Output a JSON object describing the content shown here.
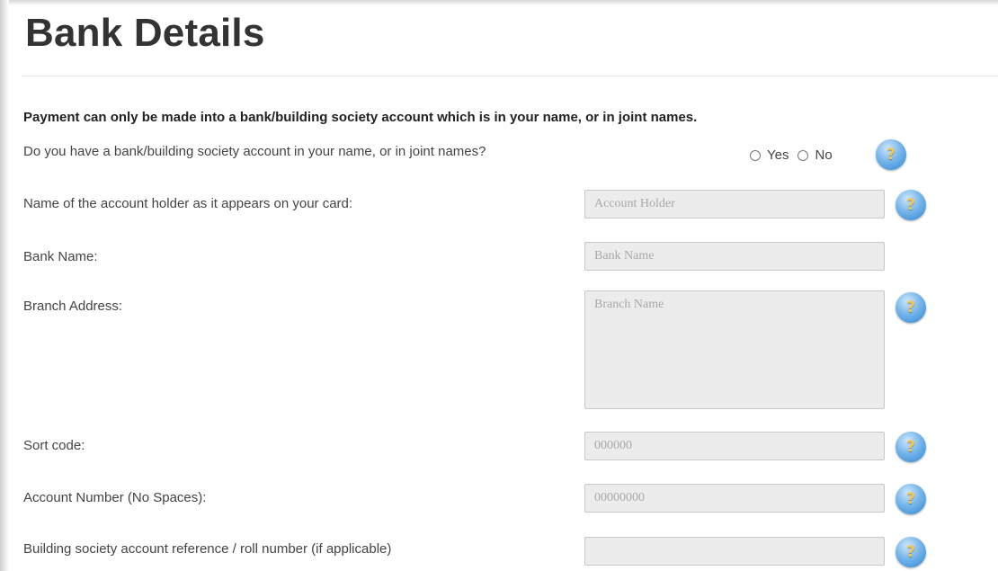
{
  "page": {
    "title": "Bank Details",
    "notice": "Payment can only be made into a bank/building society account which is in your name, or in joint names."
  },
  "question": {
    "label": "Do you have a bank/building society account in your name, or in joint names?",
    "options": [
      "Yes",
      "No"
    ]
  },
  "fields": {
    "account_holder": {
      "label": "Name of the account holder as it appears on your card:",
      "placeholder": "Account Holder",
      "value": ""
    },
    "bank_name": {
      "label": "Bank Name:",
      "placeholder": "Bank Name",
      "value": ""
    },
    "branch_address": {
      "label": "Branch Address:",
      "placeholder": "Branch Name",
      "value": ""
    },
    "sort_code": {
      "label": "Sort code:",
      "placeholder": "000000",
      "value": ""
    },
    "account_number": {
      "label": "Account Number (No Spaces):",
      "placeholder": "00000000",
      "value": ""
    },
    "roll_number": {
      "label": "Building society account reference / roll number (if applicable)",
      "placeholder": "",
      "value": ""
    }
  },
  "help": {
    "glyph": "?",
    "icon": "question-mark-icon"
  },
  "colors": {
    "title": "#333333",
    "field_background": "#ececec",
    "help_blue": "#2f86d6",
    "help_glyph": "#f4c64a"
  }
}
